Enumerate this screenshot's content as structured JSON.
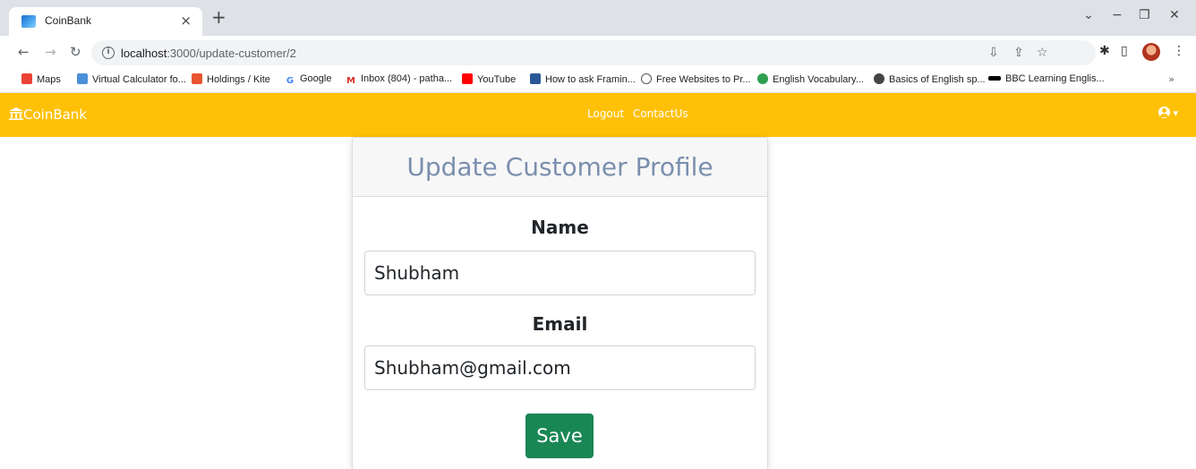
{
  "browser": {
    "tab_title": "CoinBank",
    "tab_close": "×",
    "new_tab": "+",
    "url_host": "localhost",
    "url_path": ":3000/update-customer/2",
    "bookmarks": [
      {
        "label": "Maps",
        "icon": "maps-icon",
        "color": "#ea4335"
      },
      {
        "label": "Virtual Calculator fo...",
        "icon": "calculator-icon",
        "color": "#4a90d9"
      },
      {
        "label": "Holdings / Kite",
        "icon": "kite-icon",
        "color": "#e8542f"
      },
      {
        "label": "Google",
        "icon": "google-icon",
        "color": "#4285f4"
      },
      {
        "label": "Inbox (804) - patha...",
        "icon": "gmail-icon",
        "color": "#d93025"
      },
      {
        "label": "YouTube",
        "icon": "youtube-icon",
        "color": "#ff0000"
      },
      {
        "label": "How to ask Framin...",
        "icon": "framer-icon",
        "color": "#2b5797"
      },
      {
        "label": "Free Websites to Pr...",
        "icon": "globe-icon",
        "color": "#555555"
      },
      {
        "label": "English Vocabulary...",
        "icon": "globe-icon",
        "color": "#2e9e4f"
      },
      {
        "label": "Basics of English sp...",
        "icon": "globe-icon",
        "color": "#444444"
      },
      {
        "label": "BBC Learning Englis...",
        "icon": "bbc-icon",
        "color": "#000000"
      }
    ],
    "bookmarks_more": "»"
  },
  "app": {
    "brand": "CoinBank",
    "nav_links": [
      "Logout",
      "ContactUs"
    ],
    "accent_color": "#ffc107",
    "user_caret": "▾"
  },
  "form": {
    "title": "Update Customer Profile",
    "name_label": "Name",
    "name_value": "Shubham",
    "email_label": "Email",
    "email_value": "Shubham@gmail.com",
    "save_label": "Save",
    "save_color": "#198754"
  }
}
